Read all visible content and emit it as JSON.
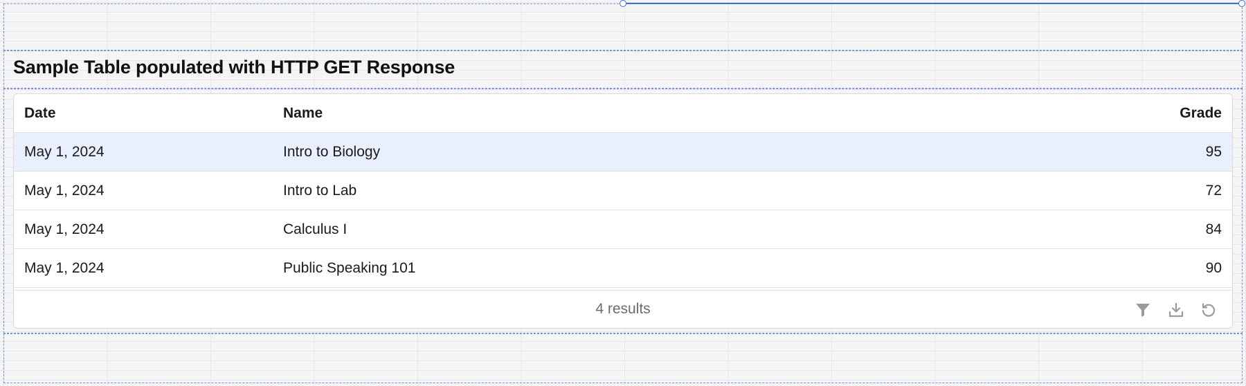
{
  "page": {
    "title": "Sample Table populated with HTTP GET Response"
  },
  "table": {
    "columns": {
      "date": "Date",
      "name": "Name",
      "grade": "Grade"
    },
    "rows": [
      {
        "date": "May 1, 2024",
        "name": "Intro to Biology",
        "grade": "95"
      },
      {
        "date": "May 1, 2024",
        "name": "Intro to Lab",
        "grade": "72"
      },
      {
        "date": "May 1, 2024",
        "name": "Calculus I",
        "grade": "84"
      },
      {
        "date": "May 1, 2024",
        "name": "Public Speaking 101",
        "grade": "90"
      }
    ],
    "footer": {
      "results_text": "4 results",
      "icons": [
        "filter-icon",
        "download-icon",
        "reset-icon"
      ]
    }
  },
  "colors": {
    "selection": "#3b6fe0",
    "row_highlight": "#e9effc",
    "icon_gray": "#9a9a9a"
  }
}
